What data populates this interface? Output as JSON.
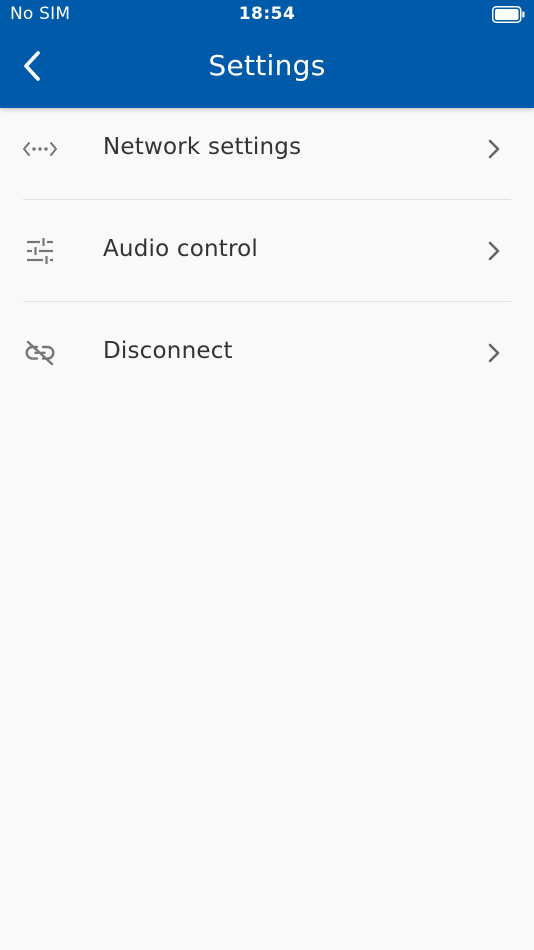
{
  "status_bar": {
    "carrier": "No SIM",
    "time": "18:54",
    "battery_icon": "battery-full-icon"
  },
  "nav": {
    "title": "Settings",
    "back_icon": "chevron-left-icon"
  },
  "settings_items": [
    {
      "label": "Network settings",
      "icon": "network-code-icon"
    },
    {
      "label": "Audio control",
      "icon": "sliders-icon"
    },
    {
      "label": "Disconnect",
      "icon": "link-off-icon"
    }
  ],
  "colors": {
    "header": "#005aaa",
    "background": "#f9f9f9",
    "text": "#333333",
    "icon": "#777777",
    "divider": "#e2e2e2"
  }
}
